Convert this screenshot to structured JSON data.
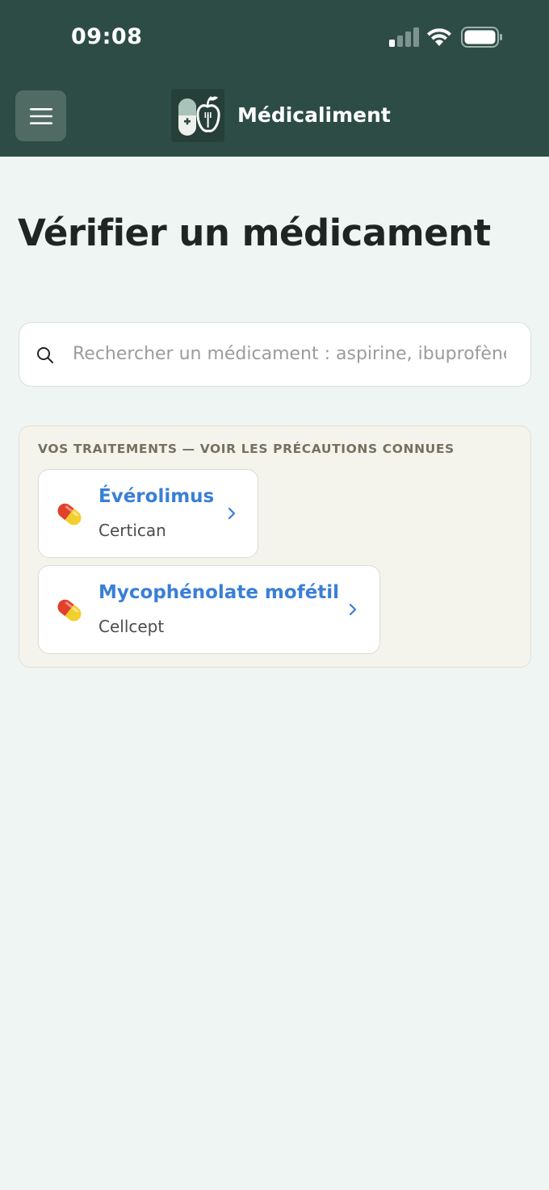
{
  "status_bar": {
    "time": "09:08"
  },
  "header": {
    "app_title": "Médicaliment",
    "icons": {
      "menu": "hamburger-menu-icon",
      "logo": "pill-apple-logo"
    },
    "colors": {
      "background": "#2d4c45",
      "menu_button": "#4f6b64"
    }
  },
  "main": {
    "page_title": "Vérifier un médicament",
    "search": {
      "placeholder": "Rechercher un médicament : aspirine, ibuprofène…",
      "value": ""
    },
    "treatments": {
      "heading": "VOS TRAITEMENTS — VOIR LES PRÉCAUTIONS CONNUES",
      "items": [
        {
          "name": "Évérolimus",
          "brand": "Certican"
        },
        {
          "name": "Mycophénolate mofétil",
          "brand": "Cellcept"
        }
      ]
    }
  },
  "colors": {
    "accent_link": "#3a7fd6",
    "page_background": "#eff5f2",
    "panel_background": "#f4f3ec"
  }
}
